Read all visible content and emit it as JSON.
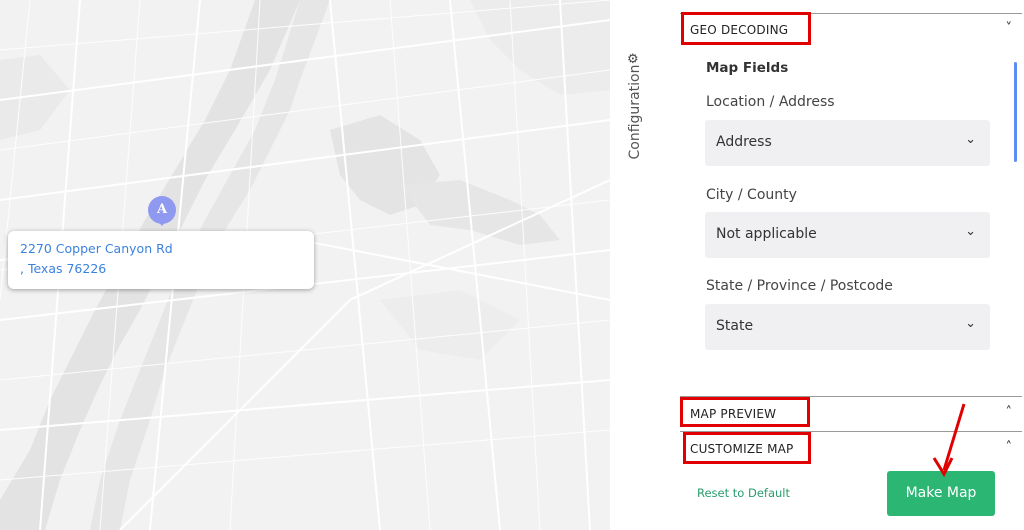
{
  "map": {
    "popup_line1": "2270 Copper Canyon Rd",
    "popup_line2": ", Texas 76226",
    "marker_letter": "A"
  },
  "config_tab": {
    "label": "Configuration",
    "icon": "gear-icon"
  },
  "sections": {
    "geo_decoding": {
      "title": "GEO DECODING",
      "chevron": "˅"
    },
    "map_preview": {
      "title": "MAP PREVIEW",
      "chevron": "˄"
    },
    "customize_map": {
      "title": "CUSTOMIZE MAP",
      "chevron": "˄"
    }
  },
  "map_fields": {
    "heading": "Map Fields",
    "location_label": "Location / Address",
    "location_value": "Address",
    "city_label": "City / County",
    "city_value": "Not applicable",
    "state_label": "State / Province / Postcode",
    "state_value": "State"
  },
  "footer": {
    "reset_label": "Reset to Default",
    "make_map_label": "Make Map"
  },
  "colors": {
    "highlight": "#e00000",
    "accent_green": "#2bb673",
    "link_blue": "#3b82e0",
    "marker": "#8f99f0"
  }
}
